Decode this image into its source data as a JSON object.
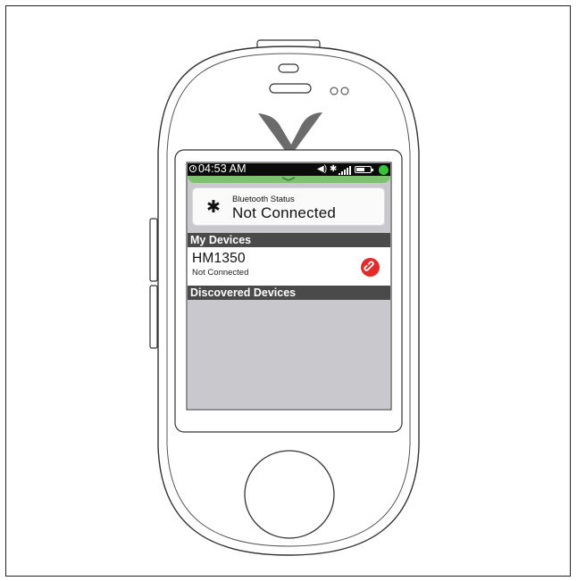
{
  "status_bar": {
    "time": "04:53 AM",
    "speaker_icon": "speaker-icon",
    "bluetooth_icon": "bluetooth-icon",
    "signal_icon": "signal-icon",
    "battery_icon": "battery-icon",
    "status_dot_color": "#38c43a"
  },
  "bluetooth_status": {
    "label": "Bluetooth Status",
    "value": "Not Connected"
  },
  "my_devices": {
    "header": "My Devices",
    "items": [
      {
        "name": "HM1350",
        "status": "Not Connected",
        "action_icon": "link-icon"
      }
    ]
  },
  "discovered_devices": {
    "header": "Discovered Devices",
    "items": []
  },
  "colors": {
    "accent_green": "#7bc46d",
    "link_red": "#e52a2a",
    "section_header": "#4a4a4a",
    "screen_bg": "#c9c8cc"
  }
}
